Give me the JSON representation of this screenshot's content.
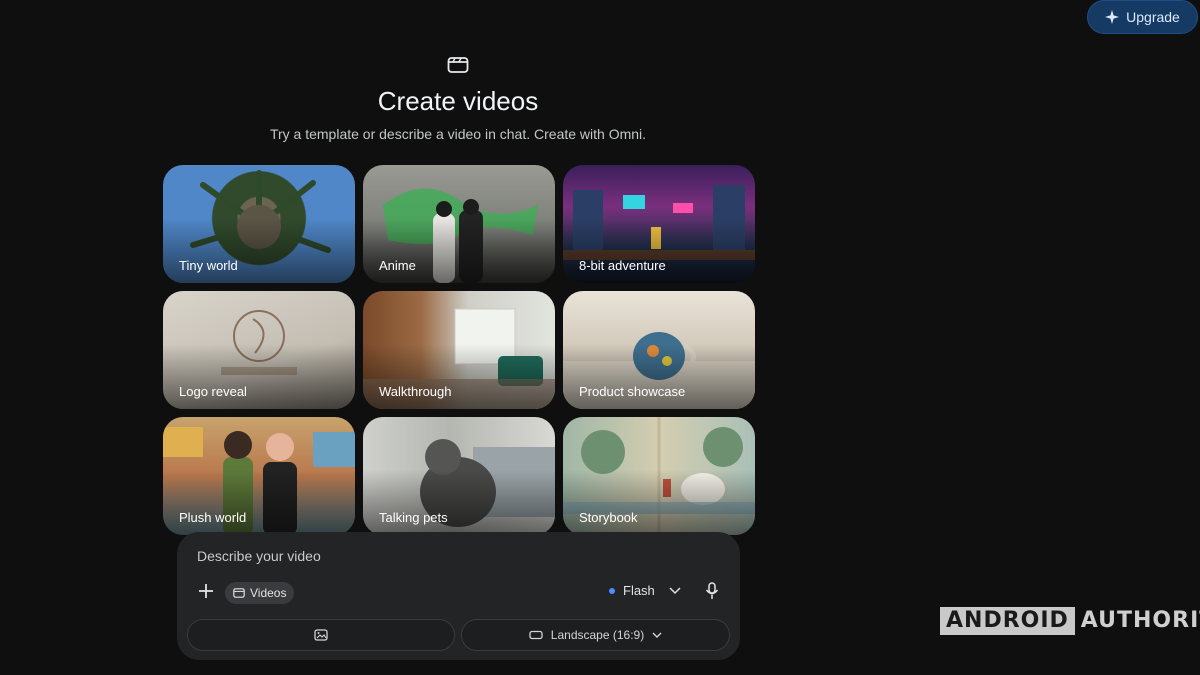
{
  "header": {
    "upgrade_label": "Upgrade",
    "title": "Create videos",
    "subtitle": "Try a template or describe a video in chat. Create with Omni."
  },
  "templates": [
    {
      "label": "Tiny world"
    },
    {
      "label": "Anime"
    },
    {
      "label": "8-bit adventure"
    },
    {
      "label": "Logo reveal"
    },
    {
      "label": "Walkthrough"
    },
    {
      "label": "Product showcase"
    },
    {
      "label": "Plush world"
    },
    {
      "label": "Talking pets"
    },
    {
      "label": "Storybook"
    }
  ],
  "prompt": {
    "placeholder": "Describe your video",
    "chip_label": "Videos",
    "model_label": "Flash",
    "aspect_label": "Landscape (16:9)"
  },
  "watermark": {
    "part1": "ANDROID",
    "part2": "AUTHORITY"
  },
  "colors": {
    "background": "#0f0f10",
    "accent": "#4f8cff",
    "upgrade_bg": "#153a64"
  }
}
